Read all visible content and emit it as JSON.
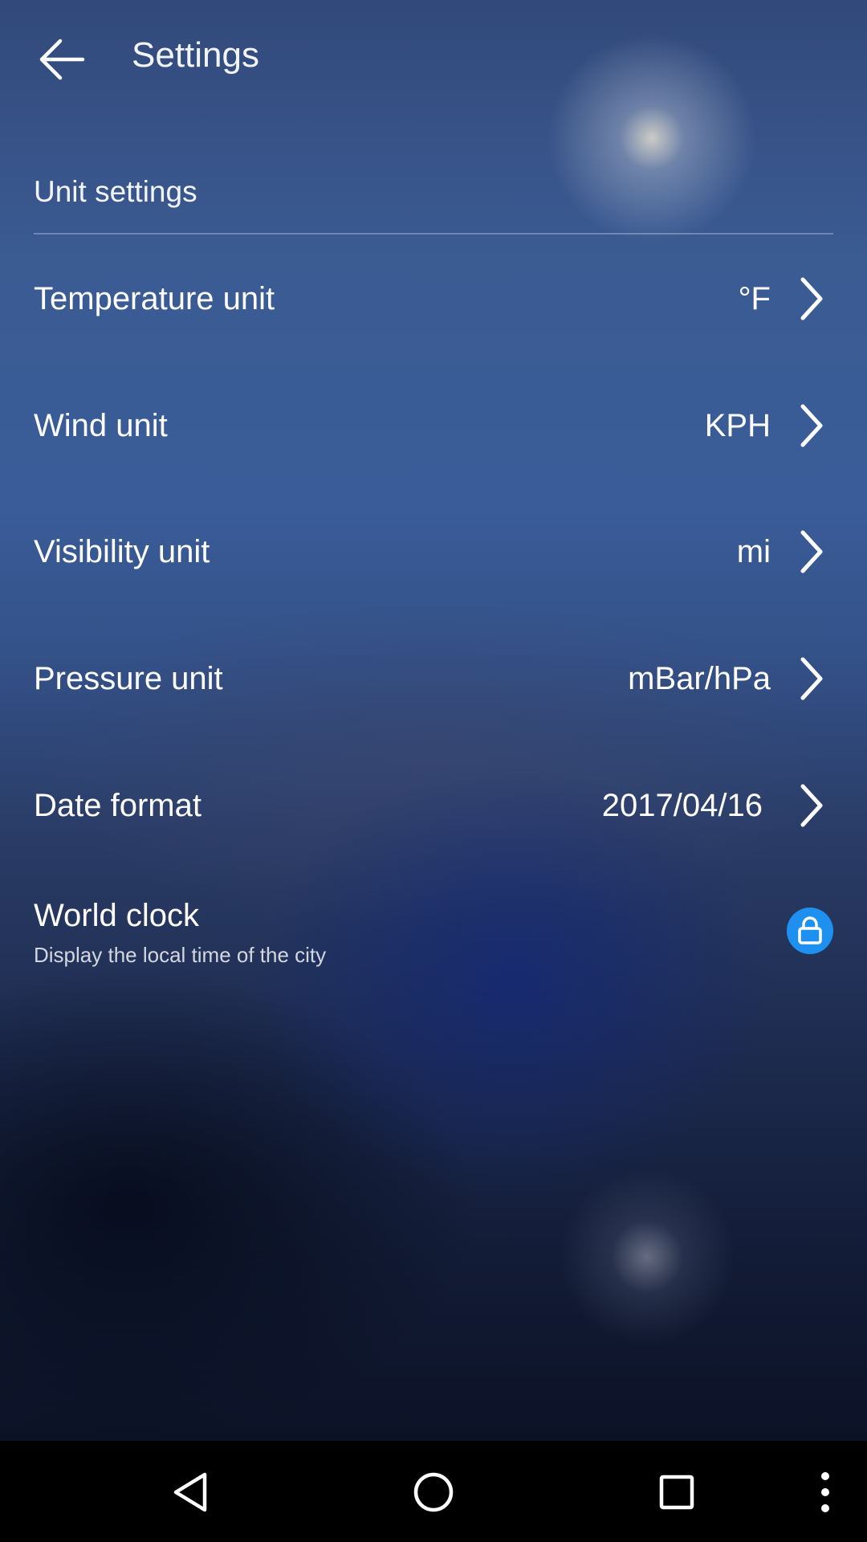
{
  "header": {
    "title": "Settings"
  },
  "section": {
    "title": "Unit settings"
  },
  "rows": [
    {
      "label": "Temperature unit",
      "value": "°F"
    },
    {
      "label": "Wind unit",
      "value": "KPH"
    },
    {
      "label": "Visibility unit",
      "value": "mi"
    },
    {
      "label": "Pressure unit",
      "value": "mBar/hPa"
    },
    {
      "label": "Date format",
      "value": "2017/04/16"
    }
  ],
  "world_clock": {
    "title": "World clock",
    "subtitle": "Display the local time of the city",
    "lock_color": "#1e90f0"
  },
  "icons": {
    "back": "arrow-left-icon",
    "chevron": "chevron-right-icon",
    "lock": "lock-icon",
    "nav_back": "triangle-back-icon",
    "nav_home": "circle-home-icon",
    "nav_recents": "square-recents-icon",
    "nav_menu": "dots-vertical-icon"
  }
}
